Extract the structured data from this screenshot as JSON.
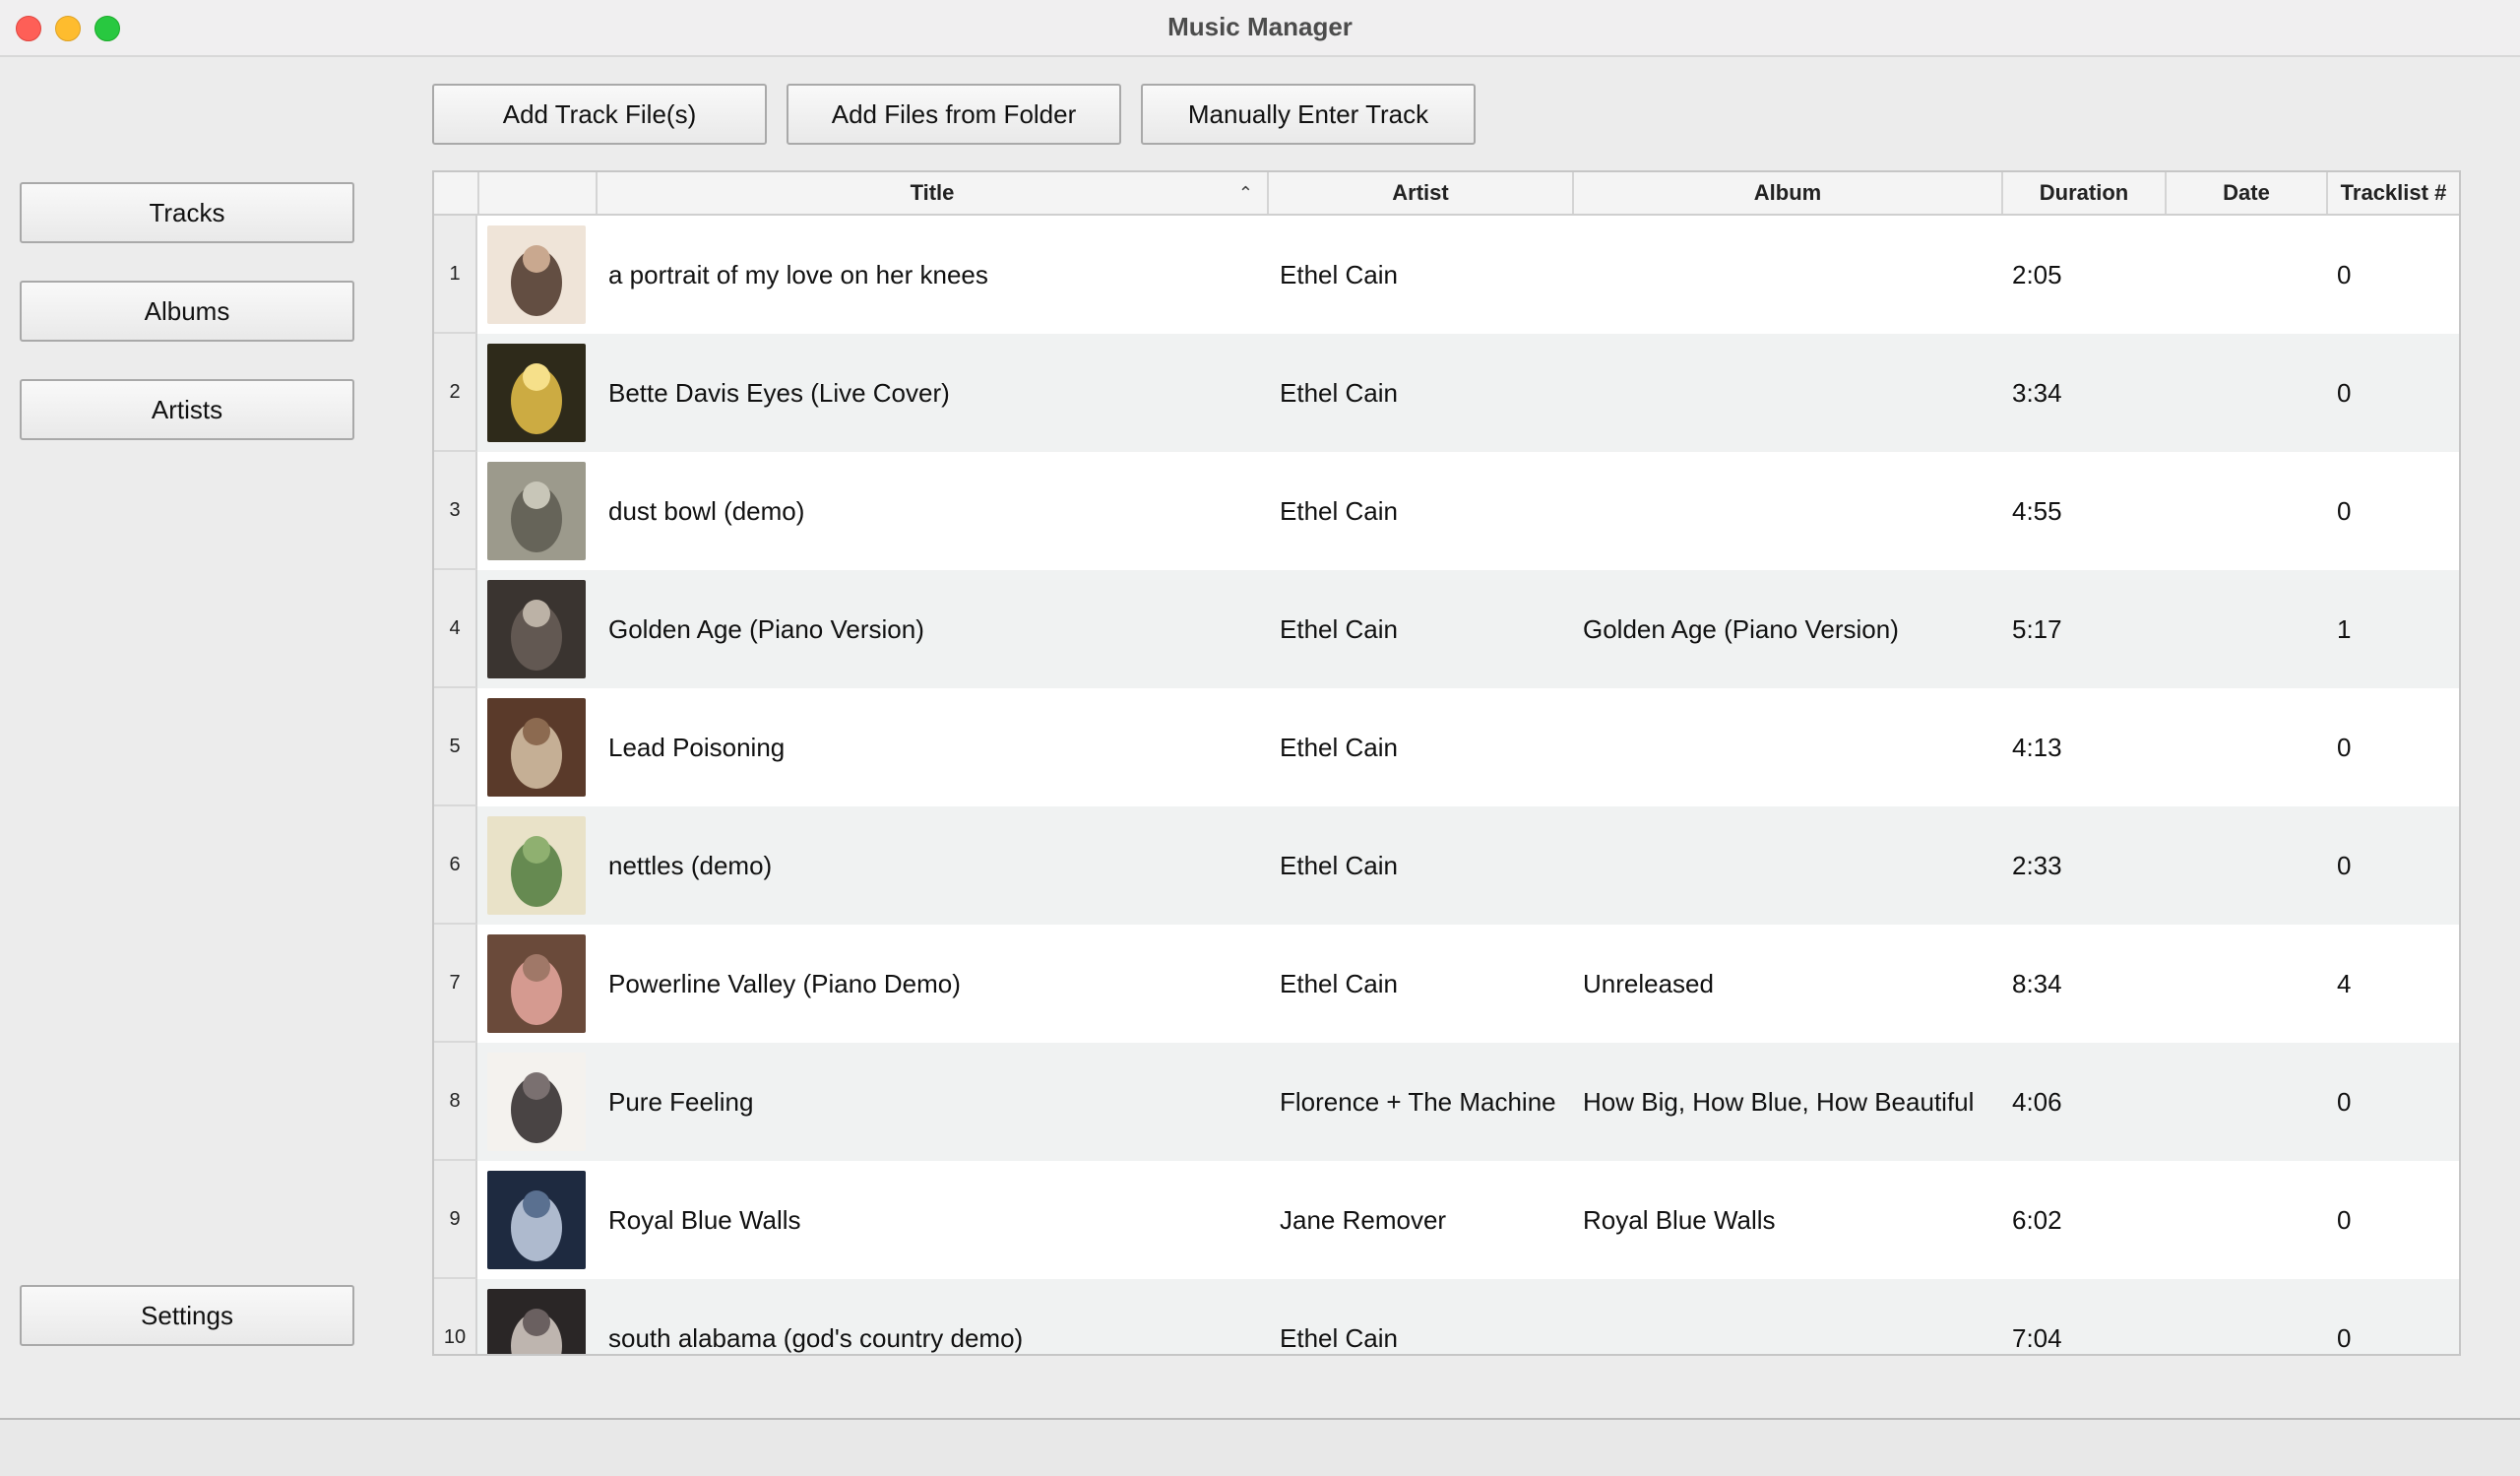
{
  "window": {
    "title": "Music Manager"
  },
  "sidebar": {
    "tracks_label": "Tracks",
    "albums_label": "Albums",
    "artists_label": "Artists",
    "settings_label": "Settings"
  },
  "toolbar": {
    "add_files_label": "Add Track File(s)",
    "add_folder_label": "Add Files from Folder",
    "manual_entry_label": "Manually Enter Track"
  },
  "table": {
    "columns": {
      "title": "Title",
      "artist": "Artist",
      "album": "Album",
      "duration": "Duration",
      "date": "Date",
      "tracklist": "Tracklist #"
    },
    "sort": {
      "column": "Title",
      "direction": "ascending",
      "icon": "chevron-up-icon"
    },
    "rows": [
      {
        "num": "1",
        "title": "a portrait of my love on her knees",
        "artist": "Ethel Cain",
        "album": "",
        "duration": "2:05",
        "date": "",
        "tracklist": "0"
      },
      {
        "num": "2",
        "title": "Bette Davis Eyes (Live Cover)",
        "artist": "Ethel Cain",
        "album": "",
        "duration": "3:34",
        "date": "",
        "tracklist": "0"
      },
      {
        "num": "3",
        "title": "dust bowl (demo)",
        "artist": "Ethel Cain",
        "album": "",
        "duration": "4:55",
        "date": "",
        "tracklist": "0"
      },
      {
        "num": "4",
        "title": "Golden Age (Piano Version)",
        "artist": "Ethel Cain",
        "album": "Golden Age (Piano Version)",
        "duration": "5:17",
        "date": "",
        "tracklist": "1"
      },
      {
        "num": "5",
        "title": "Lead Poisoning",
        "artist": "Ethel Cain",
        "album": "",
        "duration": "4:13",
        "date": "",
        "tracklist": "0"
      },
      {
        "num": "6",
        "title": "nettles (demo)",
        "artist": "Ethel Cain",
        "album": "",
        "duration": "2:33",
        "date": "",
        "tracklist": "0"
      },
      {
        "num": "7",
        "title": "Powerline Valley (Piano Demo)",
        "artist": "Ethel Cain",
        "album": "Unreleased",
        "duration": "8:34",
        "date": "",
        "tracklist": "4"
      },
      {
        "num": "8",
        "title": "Pure Feeling",
        "artist": "Florence + The Machine",
        "album": "How Big, How Blue, How Beautiful",
        "duration": "4:06",
        "date": "",
        "tracklist": "0"
      },
      {
        "num": "9",
        "title": "Royal Blue Walls",
        "artist": "Jane Remover",
        "album": "Royal Blue Walls",
        "duration": "6:02",
        "date": "",
        "tracklist": "0"
      },
      {
        "num": "10",
        "title": "south alabama (god's country demo)",
        "artist": "Ethel Cain",
        "album": "",
        "duration": "7:04",
        "date": "",
        "tracklist": "0"
      }
    ]
  },
  "colors": {
    "close": "#fe5f57",
    "minimize": "#febc2e",
    "maximize": "#28c840",
    "row_alt": "#f0f2f2"
  },
  "art_palettes": [
    {
      "bg": "#efe4d8",
      "fg": "#4a3428",
      "accent": "#c9a88f"
    },
    {
      "bg": "#2e2a1a",
      "fg": "#e8c24a",
      "accent": "#f6e08a"
    },
    {
      "bg": "#9c9a8c",
      "fg": "#5d5a50",
      "accent": "#c8c6b8"
    },
    {
      "bg": "#3a3430",
      "fg": "#6a5f58",
      "accent": "#bcb2a6"
    },
    {
      "bg": "#5a3a2a",
      "fg": "#d8c4a8",
      "accent": "#8c6a50"
    },
    {
      "bg": "#e9e2c8",
      "fg": "#4f7a3c",
      "accent": "#8fb070"
    },
    {
      "bg": "#6a4a3a",
      "fg": "#e8a8a0",
      "accent": "#a07868"
    },
    {
      "bg": "#f4f2ee",
      "fg": "#2a2626",
      "accent": "#7a7070"
    },
    {
      "bg": "#1e2a40",
      "fg": "#c8d4e8",
      "accent": "#5a7090"
    },
    {
      "bg": "#2a2626",
      "fg": "#d8cfc8",
      "accent": "#6a6060"
    }
  ]
}
